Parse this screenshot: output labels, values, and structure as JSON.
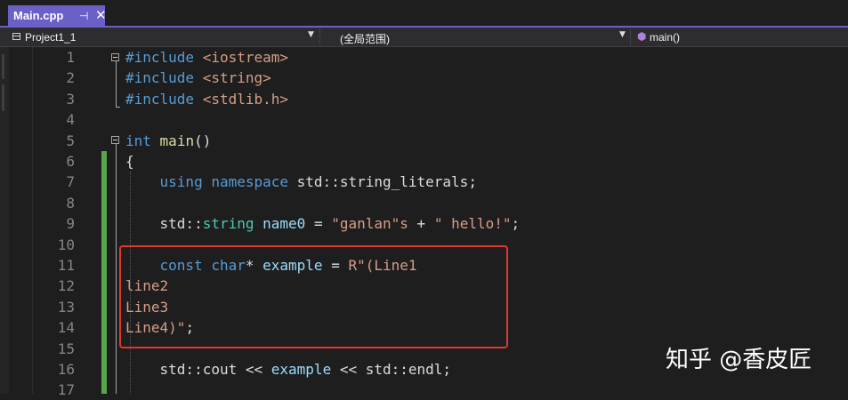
{
  "tab": {
    "title": "Main.cpp",
    "pin_glyph": "⊣",
    "close_glyph": "✕"
  },
  "navbar": {
    "project": "Project1_1",
    "scope": "(全局范围)",
    "member": "main()"
  },
  "lines": [
    {
      "num": "1",
      "tokens": [
        [
          "kw",
          "#include "
        ],
        [
          "str",
          "<iostream>"
        ]
      ]
    },
    {
      "num": "2",
      "tokens": [
        [
          "kw",
          "#include "
        ],
        [
          "str",
          "<string>"
        ]
      ]
    },
    {
      "num": "3",
      "tokens": [
        [
          "kw",
          "#include "
        ],
        [
          "str",
          "<stdlib.h>"
        ]
      ]
    },
    {
      "num": "4",
      "tokens": []
    },
    {
      "num": "5",
      "tokens": [
        [
          "kw",
          "int"
        ],
        [
          "pl",
          " "
        ],
        [
          "fn",
          "main"
        ],
        [
          "pl",
          "()"
        ]
      ]
    },
    {
      "num": "6",
      "tokens": [
        [
          "pl",
          "{"
        ]
      ]
    },
    {
      "num": "7",
      "tokens": [
        [
          "pl",
          "    "
        ],
        [
          "kw",
          "using namespace "
        ],
        [
          "pl",
          "std::string_literals;"
        ]
      ]
    },
    {
      "num": "8",
      "tokens": []
    },
    {
      "num": "9",
      "tokens": [
        [
          "pl",
          "    std::"
        ],
        [
          "ty",
          "string"
        ],
        [
          "pl",
          " "
        ],
        [
          "vr",
          "name0"
        ],
        [
          "pl",
          " = "
        ],
        [
          "str",
          "\"ganlan\"s"
        ],
        [
          "pl",
          " + "
        ],
        [
          "str",
          "\" hello!\""
        ],
        [
          "pl",
          ";"
        ]
      ]
    },
    {
      "num": "10",
      "tokens": []
    },
    {
      "num": "11",
      "tokens": [
        [
          "pl",
          "    "
        ],
        [
          "kw",
          "const char"
        ],
        [
          "pl",
          "* "
        ],
        [
          "vr",
          "example"
        ],
        [
          "pl",
          " = "
        ],
        [
          "str",
          "R\"(Line1"
        ]
      ]
    },
    {
      "num": "12",
      "tokens": [
        [
          "str",
          "line2"
        ]
      ]
    },
    {
      "num": "13",
      "tokens": [
        [
          "str",
          "Line3"
        ]
      ]
    },
    {
      "num": "14",
      "tokens": [
        [
          "str",
          "Line4)\""
        ],
        [
          "pl",
          ";"
        ]
      ]
    },
    {
      "num": "15",
      "tokens": []
    },
    {
      "num": "16",
      "tokens": [
        [
          "pl",
          "    std::cout << "
        ],
        [
          "vr",
          "example"
        ],
        [
          "pl",
          " << std::endl;"
        ]
      ]
    },
    {
      "num": "17",
      "tokens": []
    }
  ],
  "colors": {
    "kw": "#569cd6",
    "str": "#d69d85",
    "pl": "#dcdcdc",
    "fn": "#dcdcaa",
    "ty": "#4ec9b0",
    "vr": "#9cdcfe",
    "accent": "#6b5fc8",
    "change_bar": "#57a64a",
    "highlight_border": "#e0362c"
  },
  "watermark": "知乎 @香皮匠"
}
